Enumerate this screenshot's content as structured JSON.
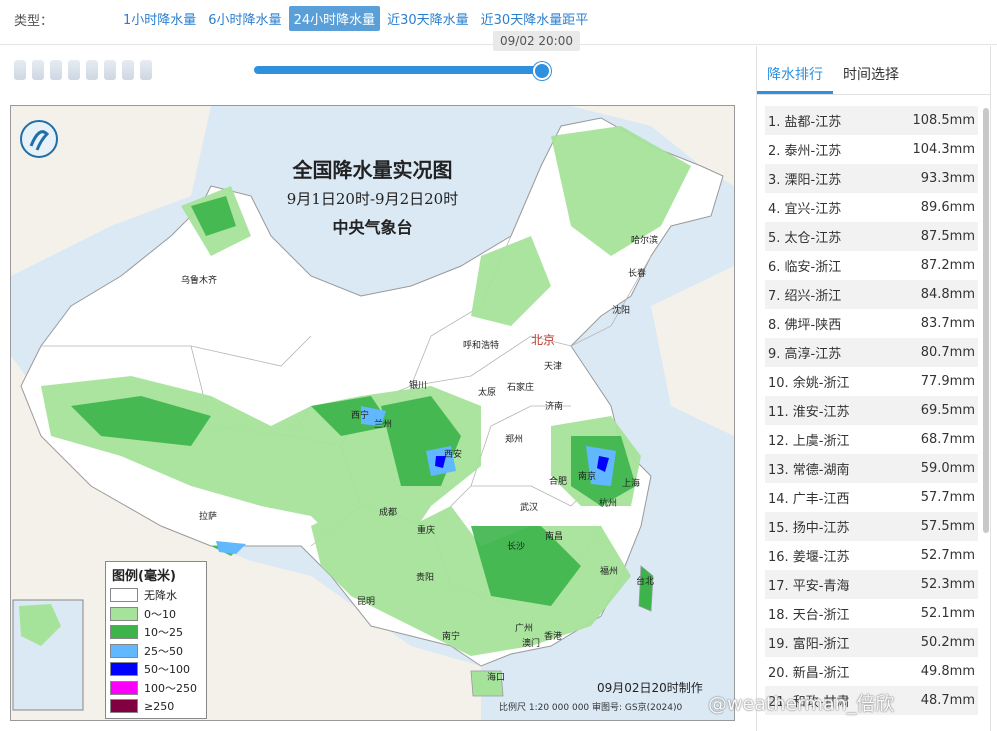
{
  "filter": {
    "type_label": "类型：",
    "tabs": [
      {
        "label": "1小时降水量",
        "active": false
      },
      {
        "label": "6小时降水量",
        "active": false
      },
      {
        "label": "24小时降水量",
        "active": true
      },
      {
        "label": "近30天降水量",
        "active": false
      },
      {
        "label": "近30天降水量距平",
        "active": false
      }
    ]
  },
  "timeline": {
    "tooltip": "09/02 20:00",
    "progress": 1.0
  },
  "map": {
    "title": "全国降水量实况图",
    "subtitle": "9月1日20时-9月2日20时",
    "org": "中央气象台",
    "made": "09月02日20时制作",
    "scale": "比例尺 1:20 000 000    审图号: GS京(2024)0",
    "legend": {
      "title": "图例(毫米)",
      "items": [
        {
          "label": "无降水",
          "color": "#ffffff"
        },
        {
          "label": "0～10",
          "color": "#a6e39a"
        },
        {
          "label": "10～25",
          "color": "#3cb44a"
        },
        {
          "label": "25～50",
          "color": "#61b8ff"
        },
        {
          "label": "50～100",
          "color": "#0000fe"
        },
        {
          "label": "100～250",
          "color": "#fa00fa"
        },
        {
          "label": "≥250",
          "color": "#810040"
        }
      ]
    },
    "cities": [
      {
        "name": "乌鲁木齐",
        "cap": false
      },
      {
        "name": "哈尔滨",
        "cap": false
      },
      {
        "name": "长春",
        "cap": false
      },
      {
        "name": "沈阳",
        "cap": false
      },
      {
        "name": "北京",
        "cap": true
      },
      {
        "name": "天津",
        "cap": false
      },
      {
        "name": "呼和浩特",
        "cap": false
      },
      {
        "name": "石家庄",
        "cap": false
      },
      {
        "name": "太原",
        "cap": false
      },
      {
        "name": "银川",
        "cap": false
      },
      {
        "name": "济南",
        "cap": false
      },
      {
        "name": "西宁",
        "cap": false
      },
      {
        "name": "兰州",
        "cap": false
      },
      {
        "name": "西安",
        "cap": false
      },
      {
        "name": "郑州",
        "cap": false
      },
      {
        "name": "合肥",
        "cap": false
      },
      {
        "name": "南京",
        "cap": false
      },
      {
        "name": "上海",
        "cap": false
      },
      {
        "name": "杭州",
        "cap": false
      },
      {
        "name": "武汉",
        "cap": false
      },
      {
        "name": "成都",
        "cap": false
      },
      {
        "name": "重庆",
        "cap": false
      },
      {
        "name": "拉萨",
        "cap": false
      },
      {
        "name": "长沙",
        "cap": false
      },
      {
        "name": "南昌",
        "cap": false
      },
      {
        "name": "福州",
        "cap": false
      },
      {
        "name": "台北",
        "cap": false
      },
      {
        "name": "贵阳",
        "cap": false
      },
      {
        "name": "昆明",
        "cap": false
      },
      {
        "name": "南宁",
        "cap": false
      },
      {
        "name": "广州",
        "cap": false
      },
      {
        "name": "香港",
        "cap": false
      },
      {
        "name": "澳门",
        "cap": false
      },
      {
        "name": "海口",
        "cap": false
      }
    ]
  },
  "panel": {
    "tabs": [
      {
        "label": "降水排行",
        "active": true
      },
      {
        "label": "时间选择",
        "active": false
      }
    ],
    "ranking": [
      {
        "name": "1. 盐都-江苏",
        "value": "108.5mm"
      },
      {
        "name": "2. 泰州-江苏",
        "value": "104.3mm"
      },
      {
        "name": "3. 溧阳-江苏",
        "value": "93.3mm"
      },
      {
        "name": "4. 宜兴-江苏",
        "value": "89.6mm"
      },
      {
        "name": "5. 太仓-江苏",
        "value": "87.5mm"
      },
      {
        "name": "6. 临安-浙江",
        "value": "87.2mm"
      },
      {
        "name": "7. 绍兴-浙江",
        "value": "84.8mm"
      },
      {
        "name": "8. 佛坪-陕西",
        "value": "83.7mm"
      },
      {
        "name": "9. 高淳-江苏",
        "value": "80.7mm"
      },
      {
        "name": "10. 余姚-浙江",
        "value": "77.9mm"
      },
      {
        "name": "11. 淮安-江苏",
        "value": "69.5mm"
      },
      {
        "name": "12. 上虞-浙江",
        "value": "68.7mm"
      },
      {
        "name": "13. 常德-湖南",
        "value": "59.0mm"
      },
      {
        "name": "14. 广丰-江西",
        "value": "57.7mm"
      },
      {
        "name": "15. 扬中-江苏",
        "value": "57.5mm"
      },
      {
        "name": "16. 姜堰-江苏",
        "value": "52.7mm"
      },
      {
        "name": "17. 平安-青海",
        "value": "52.3mm"
      },
      {
        "name": "18. 天台-浙江",
        "value": "52.1mm"
      },
      {
        "name": "19. 富阳-浙江",
        "value": "50.2mm"
      },
      {
        "name": "20. 新昌-浙江",
        "value": "49.8mm"
      },
      {
        "name": "21. 和政-甘肃",
        "value": "48.7mm"
      }
    ]
  },
  "watermark": "@weatherman_倍欣"
}
